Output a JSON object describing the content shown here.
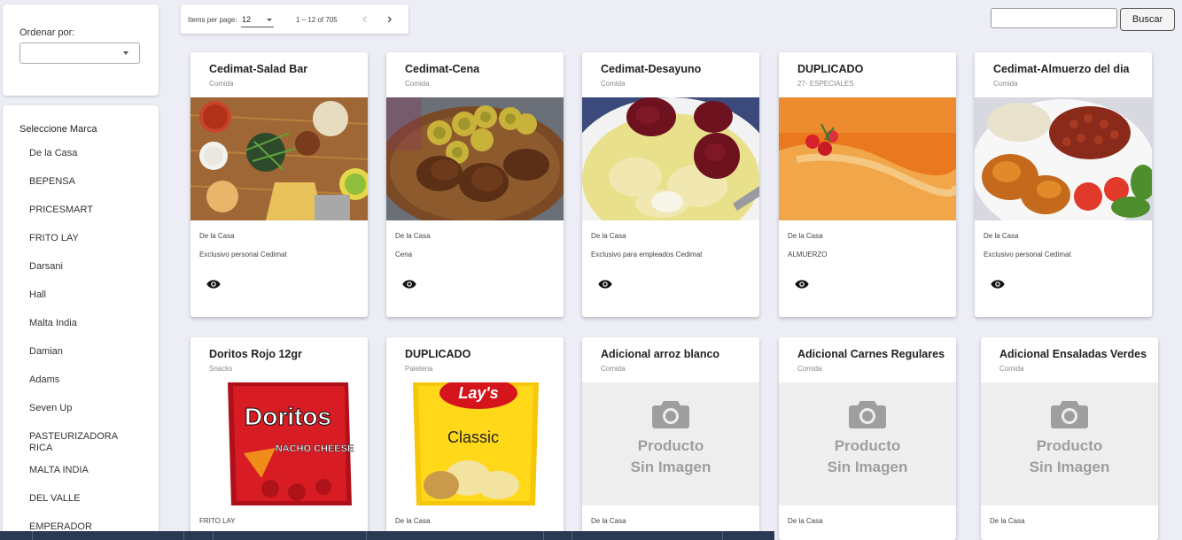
{
  "sidebar": {
    "order_label": "Ordenar por:",
    "order_value": "",
    "brand_title": "Seleccione Marca",
    "brands": [
      "De la Casa",
      "BEPENSA",
      "PRICESMART",
      "FRITO LAY",
      "Darsani",
      "Hall",
      "Malta India",
      "Damian",
      "Adams",
      "Seven Up",
      "PASTEURIZADORA RICA",
      "MALTA INDIA",
      "DEL VALLE",
      "EMPERADOR"
    ]
  },
  "paginator": {
    "items_per_page_label": "Items per page:",
    "page_size": "12",
    "range": "1 – 12 of 705",
    "prev": "‹",
    "next": "›"
  },
  "search": {
    "placeholder": "",
    "button_label": "Buscar"
  },
  "no_image": {
    "line1": "Producto",
    "line2": "Sin Imagen"
  },
  "products": [
    {
      "title": "Cedimat-Salad Bar",
      "category": "Comida",
      "brand": "De la Casa",
      "description": "Exclusivo personal Cedimat",
      "image": "salad-bar-photo"
    },
    {
      "title": "Cedimat-Cena",
      "category": "Comida",
      "brand": "De la Casa",
      "description": "Cena",
      "image": "fried-chicken-tostones-photo"
    },
    {
      "title": "Cedimat-Desayuno",
      "category": "Comida",
      "brand": "De la Casa",
      "description": "Exclusivo para empleados Cedimat",
      "image": "mangu-salami-photo"
    },
    {
      "title": "DUPLICADO",
      "category": "27- ESPECIALES",
      "brand": "De la Casa",
      "description": "ALMUERZO",
      "image": "orange-puree-tomato-photo"
    },
    {
      "title": "Cedimat-Almuerzo del dia",
      "category": "Comida",
      "brand": "De la Casa",
      "description": "Exclusivo personal Cedimat",
      "image": "rice-beans-chicken-photo"
    },
    {
      "title": "Doritos Rojo 12gr",
      "category": "Snacks",
      "brand": "FRITO LAY",
      "description": "",
      "image": "doritos-bag"
    },
    {
      "title": "DUPLICADO",
      "category": "Paleteria",
      "brand": "De la Casa",
      "description": "",
      "image": "lays-classic-bag"
    },
    {
      "title": "Adicional arroz blanco",
      "category": "Comida",
      "brand": "De la Casa",
      "description": "",
      "image": "no-image"
    },
    {
      "title": "Adicional Carnes Regulares",
      "category": "Comida",
      "brand": "De la Casa",
      "description": "",
      "image": "no-image"
    },
    {
      "title": "Adicional Ensaladas Verdes",
      "category": "Comida",
      "brand": "De la Casa",
      "description": "",
      "image": "no-image"
    }
  ],
  "brand_logos": {
    "doritos": "Doritos",
    "doritos_flavor": "NACHO CHEESE",
    "lays": "Lay's",
    "lays_flavor": "Classic"
  },
  "icons": {
    "view": "eye-icon",
    "camera": "camera-icon"
  },
  "colors": {
    "background": "#ecedf5",
    "card": "#ffffff",
    "no_image_bg": "#eeeeee",
    "no_image_text": "#9e9e9e"
  }
}
